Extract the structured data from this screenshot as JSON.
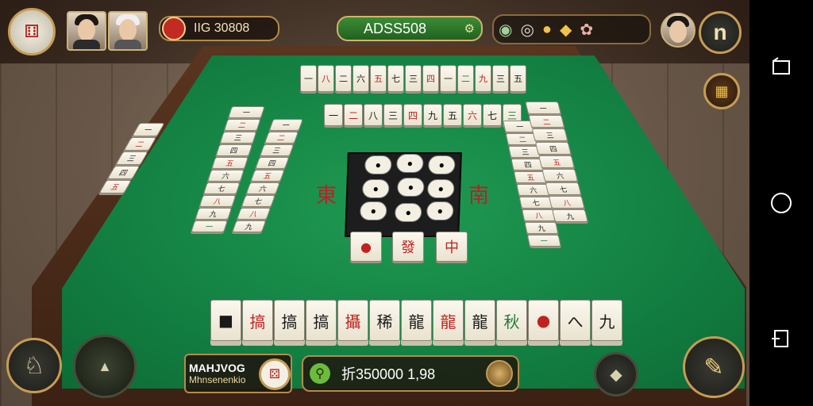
{
  "hud": {
    "player_score": "IIG 30808",
    "room_code": "ADSS508",
    "bottom_player_name": "MAHJVOG",
    "bottom_player_sub": "Mhnsenenkio",
    "balance": "折350000 1,98",
    "menu_label": "n"
  },
  "center": {
    "left_wind": "東",
    "right_wind": "南",
    "front_tiles": [
      "●",
      "發",
      "中"
    ]
  },
  "tiles": {
    "top_far": [
      "一",
      "八",
      "二",
      "六",
      "五",
      "七",
      "三",
      "四",
      "一",
      "二",
      "九",
      "三",
      "五"
    ],
    "top_near": [
      "一",
      "二",
      "八",
      "三",
      "四",
      "九",
      "五",
      "六",
      "七",
      "三"
    ],
    "left_inner": [
      "一",
      "二",
      "三",
      "四",
      "五",
      "六",
      "七",
      "八",
      "九",
      "一"
    ],
    "left_outer": [
      "一",
      "二",
      "三",
      "四",
      "五",
      "六",
      "七",
      "八",
      "九"
    ],
    "left_far": [
      "一",
      "二",
      "三",
      "四",
      "五"
    ],
    "right_inner": [
      "一",
      "二",
      "三",
      "四",
      "五",
      "六",
      "七",
      "八",
      "九",
      "一"
    ],
    "right_outer": [
      "一",
      "二",
      "三",
      "四",
      "五",
      "六",
      "七",
      "八",
      "九"
    ],
    "hand": [
      "■",
      "搞",
      "搞",
      "搞",
      "攝",
      "稀",
      "龍",
      "龍",
      "龍",
      "秋",
      "●",
      "へ",
      "九"
    ]
  },
  "colors": {
    "felt": "#138042",
    "accent_gold": "#c79c54",
    "tile_red": "#c0221f"
  },
  "icons": [
    "dice-icon",
    "coin-icon",
    "bag-icon",
    "pause-icon",
    "chest-icon",
    "chat-icon",
    "back-icon",
    "home-icon",
    "recent-icon",
    "search-icon"
  ]
}
